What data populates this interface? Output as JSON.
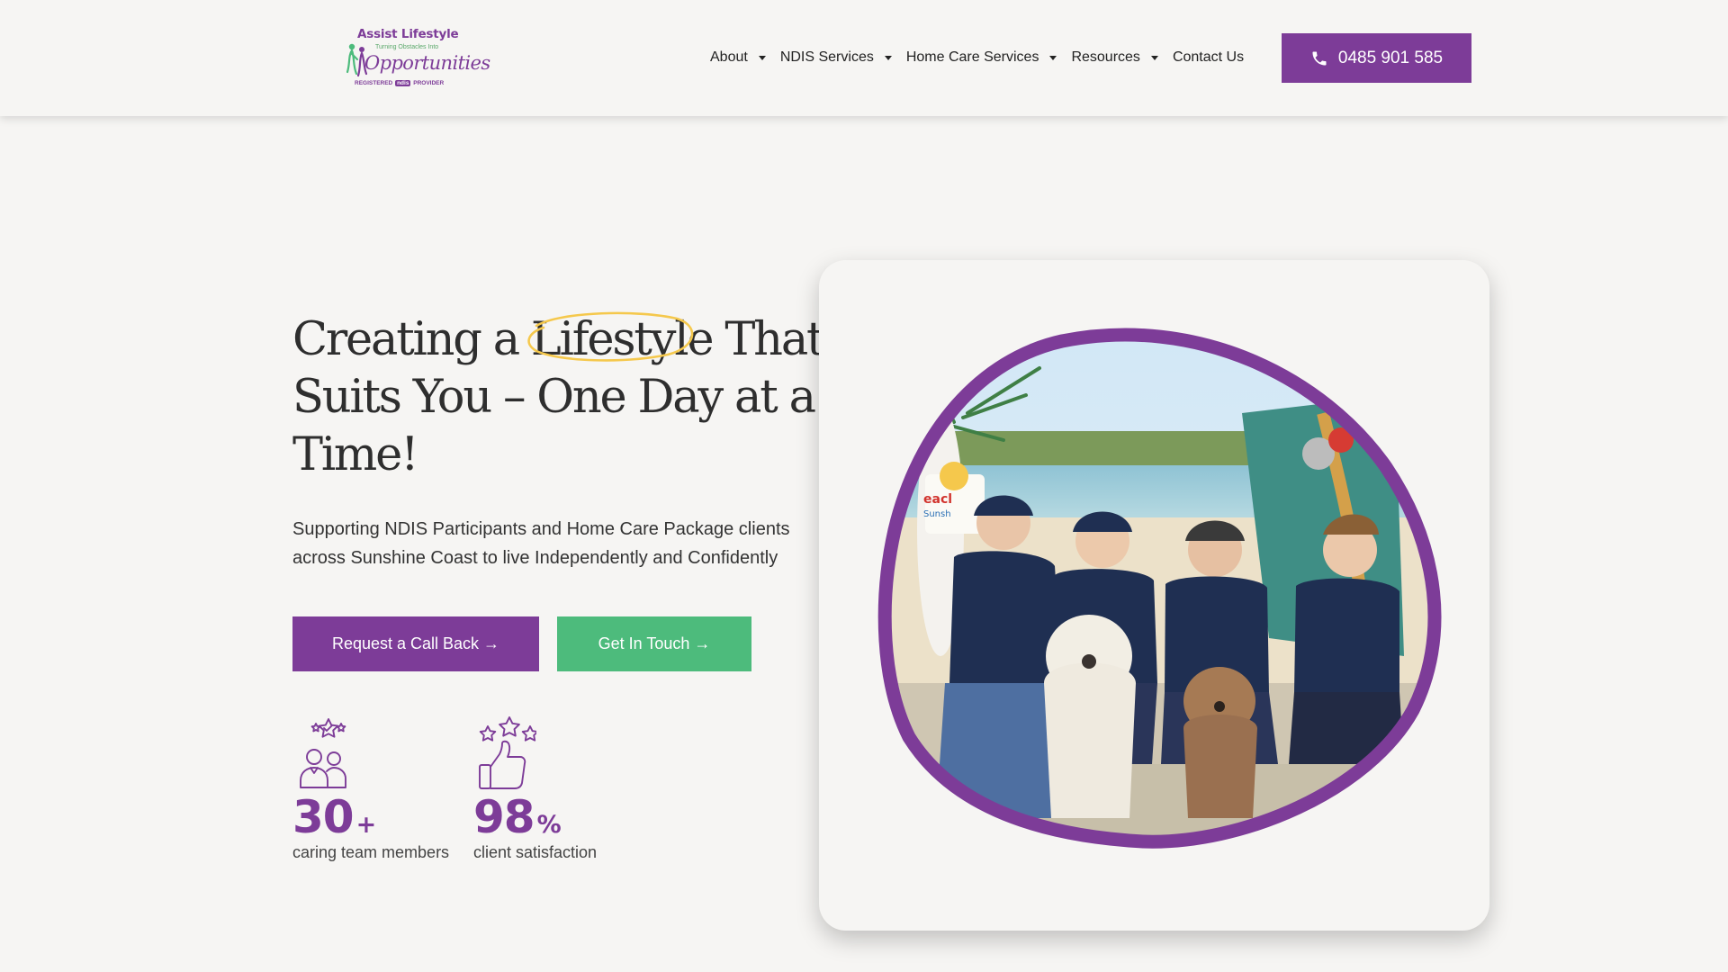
{
  "brand": {
    "name": "Assist Lifestyle",
    "tagline": "Turning Obstacles Into",
    "script_word": "Opportunities",
    "registered_prefix": "REGISTERED",
    "registered_chip": "ndis",
    "registered_suffix": "PROVIDER"
  },
  "nav": {
    "items": [
      {
        "label": "About",
        "has_dropdown": true
      },
      {
        "label": "NDIS Services",
        "has_dropdown": true
      },
      {
        "label": "Home Care Services",
        "has_dropdown": true
      },
      {
        "label": "Resources",
        "has_dropdown": true
      },
      {
        "label": "Contact Us",
        "has_dropdown": false
      }
    ],
    "phone_label": "0485 901 585",
    "phone_icon": "phone-icon"
  },
  "hero": {
    "title_before": "Creating a ",
    "title_highlight": "Lifestyle",
    "title_after": " That Suits You – One Day at a Time!",
    "subtitle": "Supporting NDIS Participants and Home Care Package clients across Sunshine Coast to live Independently and Confidently",
    "primary_button": "Request a Call Back →",
    "secondary_button": "Get In Touch →",
    "photo_sign_text": "eacl\nSunsh"
  },
  "stats": [
    {
      "value": "30",
      "suffix": "+",
      "label": "caring team members",
      "icon": "team-star-icon"
    },
    {
      "value": "98",
      "suffix": "%",
      "label": "client satisfaction",
      "icon": "thumbs-up-stars-icon"
    }
  ],
  "colors": {
    "brand_purple": "#7d3c98",
    "brand_green": "#4dbb7c",
    "background": "#f6f5f3",
    "highlight_yellow": "#f5c84c",
    "text_dark": "#2e2e2e"
  }
}
